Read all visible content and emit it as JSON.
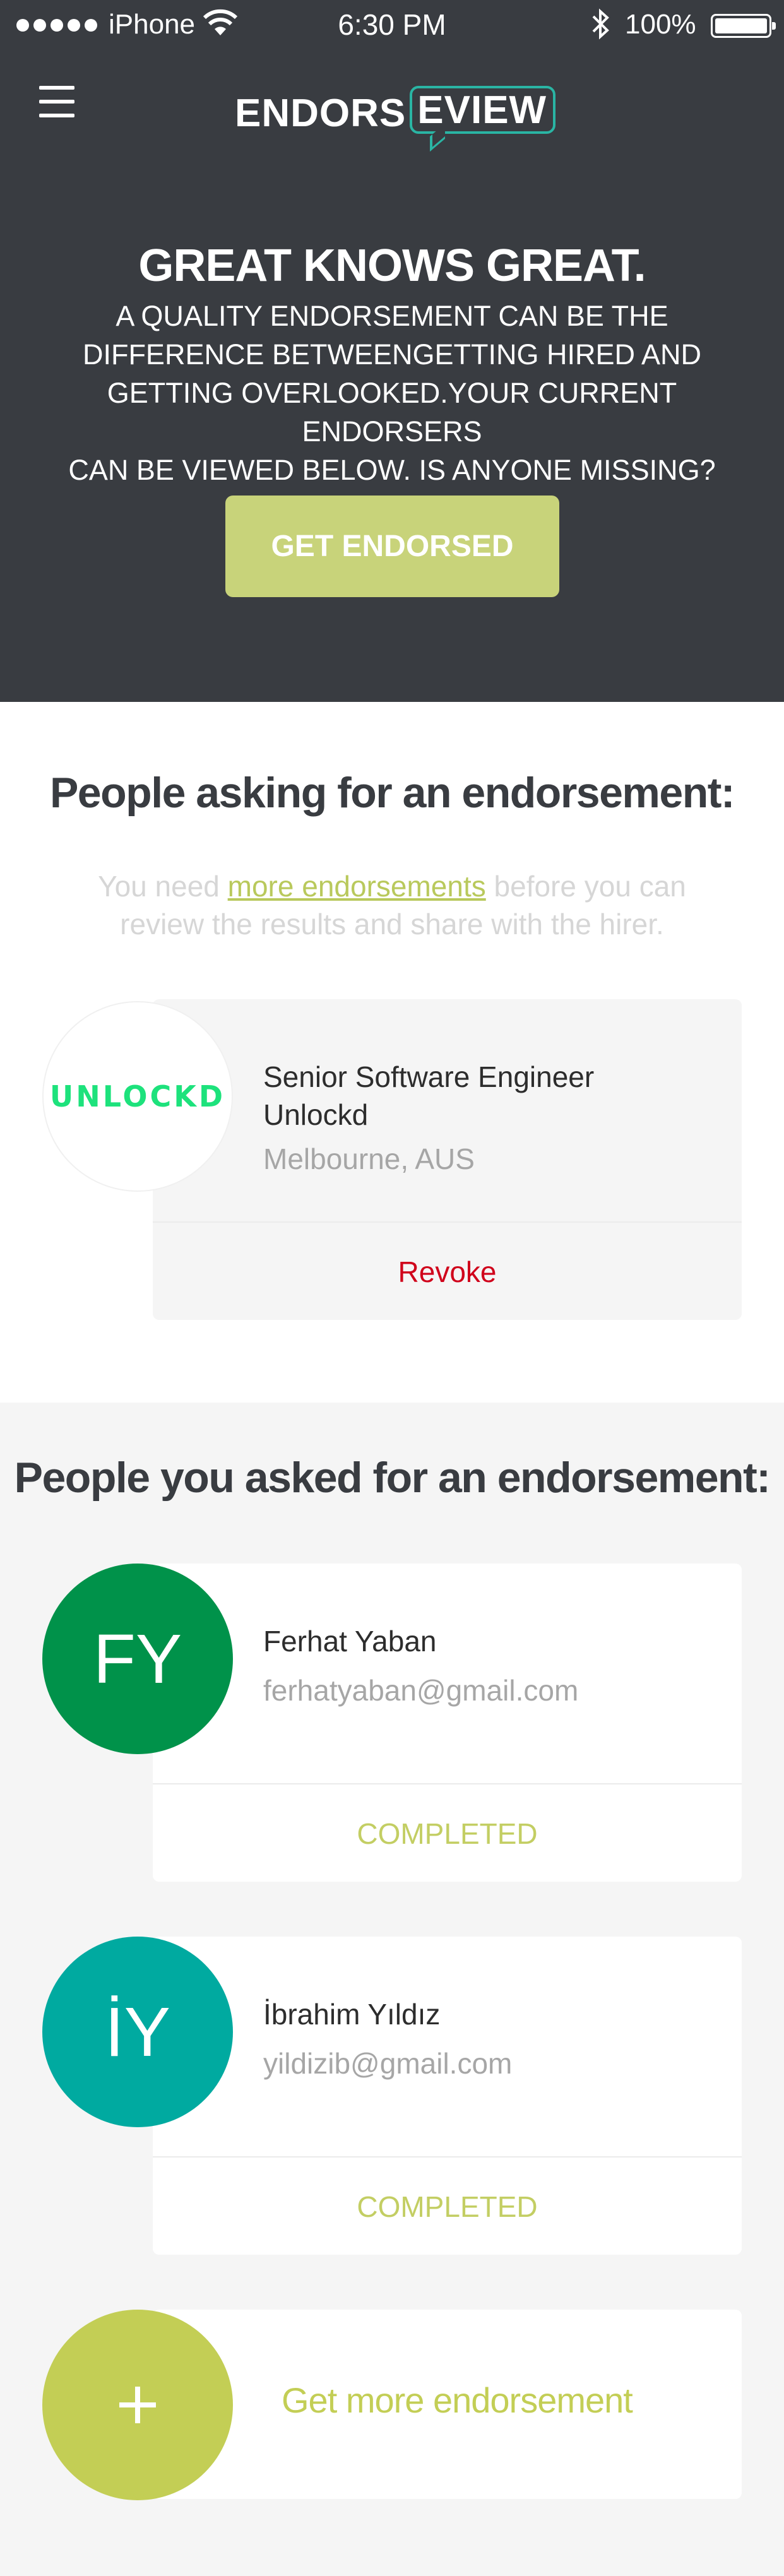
{
  "status_bar": {
    "carrier": "iPhone",
    "time": "6:30 PM",
    "battery": "100%"
  },
  "header": {
    "menu_icon": "hamburger-icon",
    "logo_left": "ENDORS",
    "logo_right": "EVIEW",
    "brand_color": "#2ab5a4",
    "background": "#393c41"
  },
  "hero": {
    "title": "GREAT KNOWS GREAT.",
    "lines": [
      "A QUALITY ENDORSEMENT CAN BE THE",
      "DIFFERENCE BETWEENGETTING HIRED AND",
      "GETTING OVERLOOKED.YOUR CURRENT ENDORSERS",
      "CAN BE VIEWED BELOW. IS ANYONE MISSING?"
    ],
    "cta_label": "GET ENDORSED",
    "cta_color": "#c8d37a"
  },
  "asking": {
    "title": "People asking for an endorsement:",
    "note_before": "You need ",
    "note_link": "more endorsements",
    "note_after": " before you can review the results and share with the hirer.",
    "items": [
      {
        "company_logo_text": "UNLOCKD",
        "role": "Senior Software Engineer",
        "company": "Unlockd",
        "location": "Melbourne, AUS",
        "action": "Revoke",
        "action_color": "#d0021b"
      }
    ]
  },
  "asked": {
    "title": "People you asked for an endorsement:",
    "items": [
      {
        "initials": "FY",
        "name": "Ferhat Yaban",
        "email": "ferhatyaban@gmail.com",
        "status": "COMPLETED",
        "avatar_color": "#00924a"
      },
      {
        "initials": "İY",
        "name": "İbrahim Yıldız",
        "email": "yildizib@gmail.com",
        "status": "COMPLETED",
        "avatar_color": "#00aaa0"
      }
    ],
    "more_icon": "plus-icon",
    "more_label": "Get more endorsement",
    "accent_color": "#c3ce55"
  }
}
